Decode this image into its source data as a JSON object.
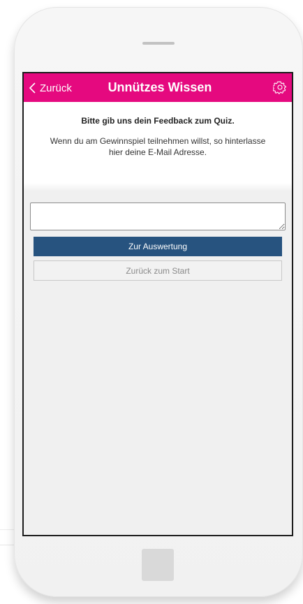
{
  "header": {
    "back_label": "Zurück",
    "title": "Unnützes Wissen"
  },
  "icons": {
    "back": "chevron-left-icon",
    "settings": "gear-icon"
  },
  "feedback": {
    "heading": "Bitte gib uns dein Feedback zum Quiz.",
    "body": "Wenn du am Gewinnspiel teilnehmen willst, so hinterlasse hier deine E-Mail Adresse.",
    "input_value": "",
    "input_placeholder": ""
  },
  "actions": {
    "primary_label": "Zur Auswertung",
    "secondary_label": "Zurück zum Start"
  },
  "colors": {
    "header_bg": "#e5097f",
    "primary_button": "#27537f",
    "screen_bg": "#f0f0f0"
  }
}
